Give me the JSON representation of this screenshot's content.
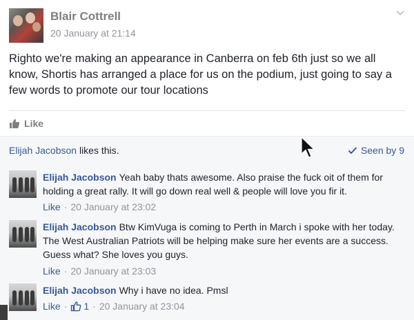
{
  "post": {
    "author": "Blair Cottrell",
    "timestamp": "20 January at 21:14",
    "body": "Righto we're making an appearance in Canberra on feb 6th just so we all know, Shortis has arranged a place for us on the podium, just going to say a few words to promote our tour locations",
    "like_label": "Like"
  },
  "summary": {
    "liker": "Elijah Jacobson",
    "likes_suffix": " likes this.",
    "seen_label": "Seen by 9"
  },
  "comments": [
    {
      "author": "Elijah Jacobson",
      "text": "Yeah baby thats awesome. Also praise the fuck oit of them for holding a great rally. It will go down real well & people will love you fir it.",
      "like_label": "Like",
      "time": "20 January at 23:02"
    },
    {
      "author": "Elijah Jacobson",
      "text": "Btw KimVuga is coming to Perth in March i spoke with her today. The West Australian Patriots will be helping make sure her events are a success. Guess what? She loves you guys.",
      "like_label": "Like",
      "time": "20 January at 23:03"
    },
    {
      "author": "Elijah Jacobson",
      "text": "Why i have no idea. Pmsl",
      "like_label": "Like",
      "reaction_count": "1",
      "time": "20 January at 23:04"
    }
  ],
  "colors": {
    "link": "#365899",
    "muted": "#90949c",
    "summary_bg": "#f6f7f9"
  },
  "icons": {
    "like": "thumbs-up-icon",
    "seen": "checkmark-icon",
    "menu": "chevron-down-icon"
  }
}
